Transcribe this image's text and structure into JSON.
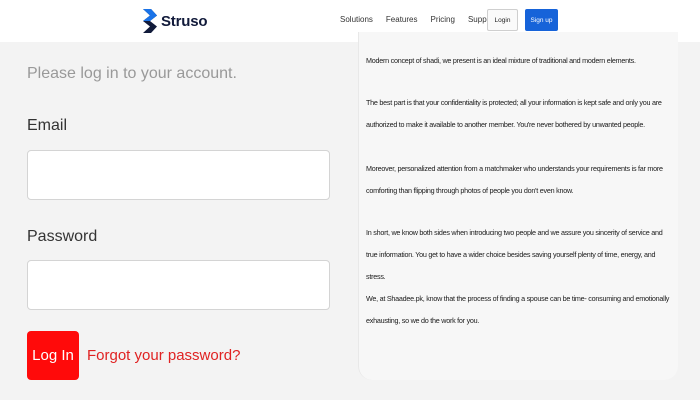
{
  "header": {
    "logo_text": "Struso",
    "nav": [
      "Solutions",
      "Features",
      "Pricing",
      "Support"
    ],
    "login_label": "Login",
    "signup_label": "Sign up",
    "colors": {
      "signup_bg": "#1663d9",
      "logo_blue": "#1a73e8",
      "logo_dark": "#111a3a"
    }
  },
  "login_form": {
    "subtitle": "Please log in to your account.",
    "email_label": "Email",
    "email_value": "",
    "password_label": "Password",
    "password_value": "",
    "submit_label": "Log In",
    "forgot_label": "Forgot your password?",
    "colors": {
      "submit_bg": "#ff0a0a",
      "forgot_text": "#e02222"
    }
  },
  "info": {
    "paragraphs": [
      "Modern concept of shadi, we present is an ideal mixture of traditional and modern elements.",
      "The best part is that your confidentiality is protected; all your information is kept safe and only you are authorized to make it available to another member. You're never bothered by unwanted people.",
      "Moreover, personalized attention from a matchmaker who understands your requirements is far more comforting than flipping through photos of people you don't even know.",
      "In short, we know both sides when introducing two people and we assure you sincerity of service and true information. You get to have a wider choice besides saving yourself plenty of time, energy, and stress.",
      "We, at Shaadee.pk, know that the process of finding a spouse can be time- consuming and emotionally exhausting, so we do the work for you."
    ]
  }
}
